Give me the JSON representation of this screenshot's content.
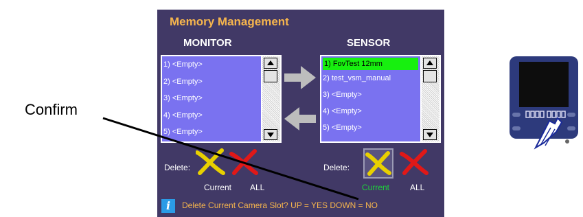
{
  "panel": {
    "title": "Memory Management",
    "monitor": {
      "heading": "MONITOR",
      "items": [
        "1) <Empty>",
        "2) <Empty>",
        "3) <Empty>",
        "4) <Empty>",
        "5) <Empty>"
      ]
    },
    "sensor": {
      "heading": "SENSOR",
      "items": [
        "1) FovTest 12mm",
        "2) test_vsm_manual",
        "3) <Empty>",
        "4) <Empty>",
        "5) <Empty>"
      ],
      "selected_index": 0
    },
    "monitor_delete": {
      "label": "Delete:",
      "current": "Current",
      "all": "ALL"
    },
    "sensor_delete": {
      "label": "Delete:",
      "current": "Current",
      "all": "ALL"
    },
    "status": {
      "icon": "info-icon",
      "text": "Delete Current Camera Slot? UP = YES DOWN = NO"
    }
  },
  "annotation": {
    "label": "Confirm"
  },
  "colors": {
    "panel_bg": "#413966",
    "title": "#f6b54d",
    "list_bg": "#7a72f0",
    "selected": "#17f00f",
    "active_caption": "#1dd43a"
  }
}
